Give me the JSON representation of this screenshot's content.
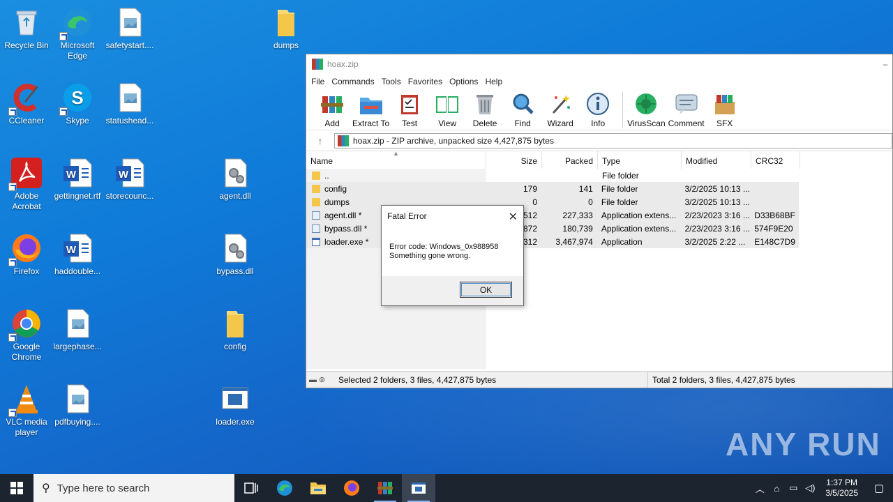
{
  "desktop": {
    "icons": [
      {
        "label": "Recycle Bin",
        "icon": "recycle-bin-icon"
      },
      {
        "label": "Microsoft Edge",
        "icon": "edge-icon"
      },
      {
        "label": "safetystart....",
        "icon": "image-file-icon"
      },
      {
        "label": "dumps",
        "icon": "folder-icon"
      },
      {
        "label": "CCleaner",
        "icon": "ccleaner-icon"
      },
      {
        "label": "Skype",
        "icon": "skype-icon"
      },
      {
        "label": "statushead...",
        "icon": "image-file-icon"
      },
      {
        "label": "Adobe Acrobat",
        "icon": "acrobat-icon"
      },
      {
        "label": "gettingnet.rtf",
        "icon": "word-icon"
      },
      {
        "label": "storecounc...",
        "icon": "word-icon"
      },
      {
        "label": "agent.dll",
        "icon": "dll-icon"
      },
      {
        "label": "Firefox",
        "icon": "firefox-icon"
      },
      {
        "label": "haddouble...",
        "icon": "word-icon"
      },
      {
        "label": "bypass.dll",
        "icon": "dll-icon"
      },
      {
        "label": "Google Chrome",
        "icon": "chrome-icon"
      },
      {
        "label": "largephase...",
        "icon": "image-file-icon"
      },
      {
        "label": "config",
        "icon": "folder-icon"
      },
      {
        "label": "VLC media player",
        "icon": "vlc-icon"
      },
      {
        "label": "pdfbuying....",
        "icon": "image-file-icon"
      },
      {
        "label": "loader.exe",
        "icon": "exe-icon"
      }
    ]
  },
  "winrar": {
    "title": "hoax.zip",
    "menu": [
      "File",
      "Commands",
      "Tools",
      "Favorites",
      "Options",
      "Help"
    ],
    "toolbar": [
      "Add",
      "Extract To",
      "Test",
      "View",
      "Delete",
      "Find",
      "Wizard",
      "Info",
      "VirusScan",
      "Comment",
      "SFX"
    ],
    "path": "hoax.zip - ZIP archive, unpacked size 4,427,875 bytes",
    "columns": {
      "name": "Name",
      "size": "Size",
      "packed": "Packed",
      "type": "Type",
      "modified": "Modified",
      "crc": "CRC32"
    },
    "rows": [
      {
        "name": "..",
        "size": "",
        "packed": "",
        "type": "File folder",
        "modified": "",
        "crc": "",
        "icon": "folder"
      },
      {
        "name": "config",
        "size": "179",
        "packed": "141",
        "type": "File folder",
        "modified": "3/2/2025 10:13 ...",
        "crc": "",
        "icon": "folder"
      },
      {
        "name": "dumps",
        "size": "0",
        "packed": "0",
        "type": "File folder",
        "modified": "3/2/2025 10:13 ...",
        "crc": "",
        "icon": "folder"
      },
      {
        "name": "agent.dll *",
        "size": "512",
        "packed": "227,333",
        "type": "Application extens...",
        "modified": "2/23/2023 3:16 ...",
        "crc": "D33B68BF",
        "icon": "dll"
      },
      {
        "name": "bypass.dll *",
        "size": "872",
        "packed": "180,739",
        "type": "Application extens...",
        "modified": "2/23/2023 3:16 ...",
        "crc": "574F9E20",
        "icon": "dll"
      },
      {
        "name": "loader.exe *",
        "size": "312",
        "packed": "3,467,974",
        "type": "Application",
        "modified": "3/2/2025 2:22 ...",
        "crc": "E148C7D9",
        "icon": "exe"
      }
    ],
    "status_left": "Selected 2 folders, 3 files, 4,427,875 bytes",
    "status_right": "Total 2 folders, 3 files, 4,427,875 bytes"
  },
  "dialog": {
    "title": "Fatal Error",
    "line1": "Error code: Windows_0x988958",
    "line2": "Something gone wrong.",
    "ok": "OK"
  },
  "watermark": "ANY RUN",
  "taskbar": {
    "search_placeholder": "Type here to search",
    "time": "1:37 PM",
    "date": "3/5/2025"
  }
}
